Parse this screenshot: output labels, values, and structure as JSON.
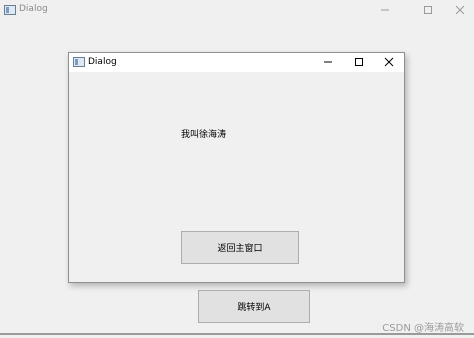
{
  "outer_window": {
    "title": "Dialog",
    "icon": "app-window-icon",
    "controls": [
      "minimize-icon",
      "maximize-icon",
      "close-icon"
    ],
    "button_label": "跳转到A"
  },
  "dialog": {
    "title": "Dialog",
    "icon": "app-window-icon",
    "controls": [
      "minimize-icon",
      "maximize-icon",
      "close-icon"
    ],
    "label_text": "我叫徐海涛",
    "button_label": "返回主窗口"
  },
  "watermark": "CSDN @海涛高软",
  "colors": {
    "window_bg": "#f0f0f0",
    "titlebar_active": "#ffffff",
    "button_bg": "#e1e1e1",
    "button_border": "#adadad",
    "inactive_text": "#8a8a8a"
  }
}
